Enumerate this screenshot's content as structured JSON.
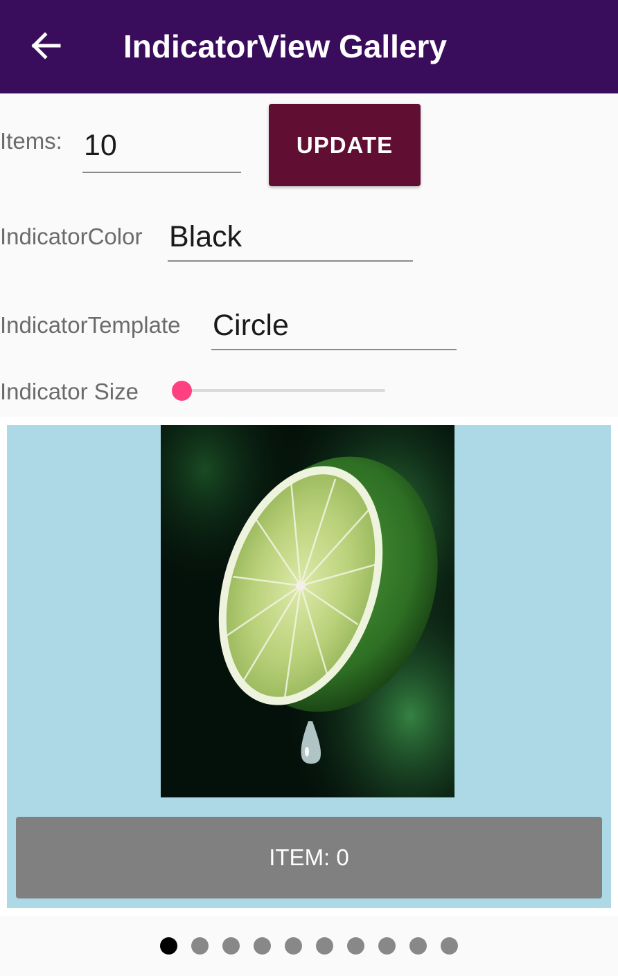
{
  "toolbar": {
    "title": "IndicatorView Gallery",
    "back_icon": "arrow-left-icon",
    "background": "#3a0d5c"
  },
  "form": {
    "items_label": "Items:",
    "items_value": "10",
    "update_label": "UPDATE",
    "update_color": "#600f33",
    "color_label": "IndicatorColor",
    "color_value": "Black",
    "template_label": "IndicatorTemplate",
    "template_value": "Circle",
    "size_label": "Indicator Size",
    "size_level": 0.0,
    "slider_color": "#ff4081"
  },
  "carousel": {
    "background": "#add8e6",
    "image": "lime-half-with-water-drop",
    "item_text": "ITEM: 0"
  },
  "indicator": {
    "count": 10,
    "position": 0,
    "color": "#888888",
    "selected_color": "#000000",
    "shape": "circle"
  }
}
